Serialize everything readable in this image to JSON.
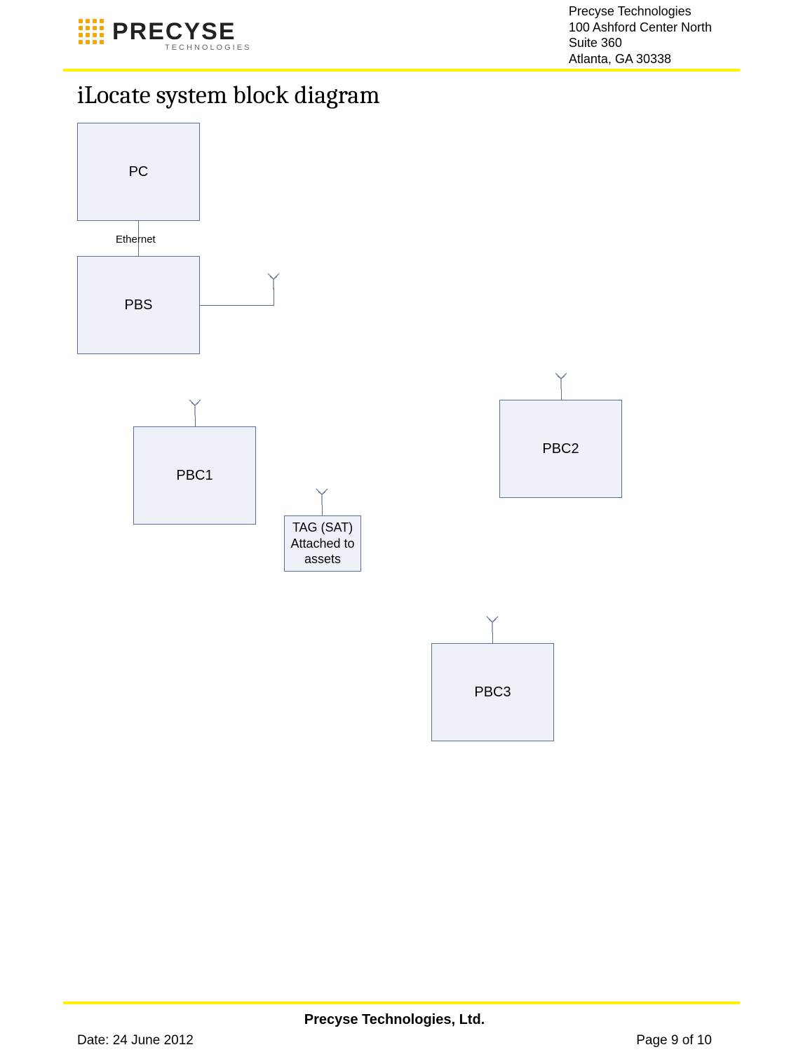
{
  "header": {
    "company": "PRECYSE",
    "subbrand": "TECHNOLOGIES",
    "address_line1": "Precyse Technologies",
    "address_line2": "100 Ashford Center North",
    "address_line3": "Suite 360",
    "address_line4": "Atlanta, GA  30338"
  },
  "title": "iLocate system block diagram",
  "diagram": {
    "pc": "PC",
    "ethernet": "Ethernet",
    "pbs": "PBS",
    "pbc1": "PBC1",
    "pbc2": "PBC2",
    "pbc3": "PBC3",
    "tag_line1": "TAG (SAT)",
    "tag_line2": "Attached to",
    "tag_line3": "assets"
  },
  "footer": {
    "company": "Precyse Technologies, Ltd.",
    "date": "Date: 24 June 2012",
    "page": "Page 9 of 10"
  }
}
